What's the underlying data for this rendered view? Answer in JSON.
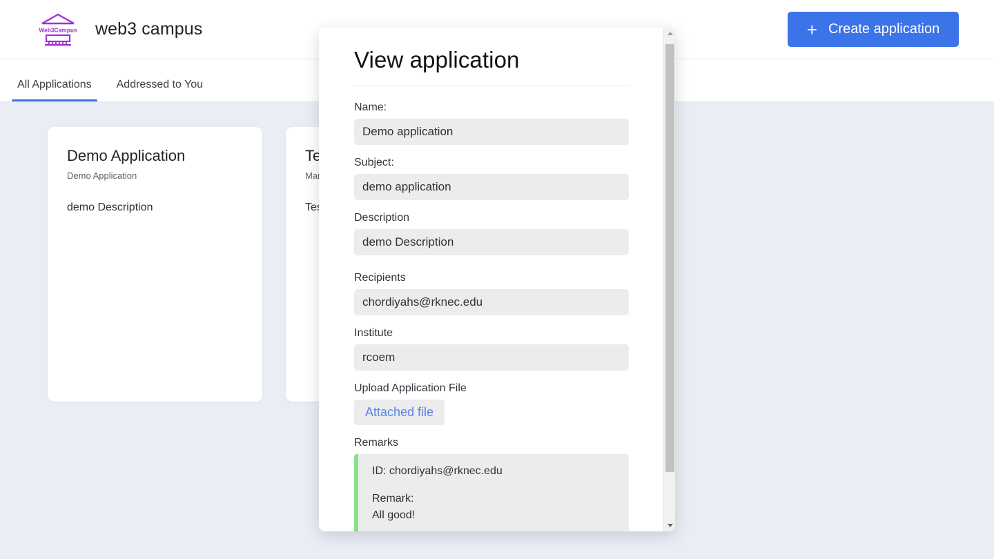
{
  "header": {
    "logo_icon": "web3campus-logo-icon",
    "logo_text": "Web3Campus",
    "brand_name": "web3 campus",
    "create_button": {
      "icon": "plus-icon",
      "icon_glyph": "+",
      "label": "Create application"
    },
    "accent_color": "#3b73e8"
  },
  "tabs": [
    {
      "label": "All Applications",
      "active": true
    },
    {
      "label": "Addressed to You",
      "active": false
    }
  ],
  "cards": [
    {
      "title": "Demo Application",
      "subtitle": "Demo Application",
      "description": "demo Description"
    },
    {
      "title": "Test",
      "subtitle": "Manage",
      "description": "Test"
    }
  ],
  "modal": {
    "title": "View application",
    "fields": [
      {
        "label": "Name:",
        "value": "Demo application"
      },
      {
        "label": "Subject:",
        "value": "demo application"
      },
      {
        "label": "Description",
        "value": "demo Description"
      },
      {
        "label": "Recipients",
        "value": "chordiyahs@rknec.edu"
      },
      {
        "label": "Institute",
        "value": "rcoem"
      }
    ],
    "upload": {
      "label": "Upload Application File",
      "button_label": "Attached file",
      "link_color": "#5b84e8"
    },
    "remarks": {
      "label": "Remarks",
      "id_line": "ID: chordiyahs@rknec.edu",
      "remark_label": "Remark:",
      "remark_text": "All good!",
      "accent_color": "#83e28a"
    },
    "scrollbar": {
      "up_icon": "chevron-up-icon",
      "down_icon": "chevron-down-icon"
    }
  },
  "colors": {
    "page_background": "#eaeef4",
    "surface": "#ffffff",
    "field_background": "#ececec",
    "primary": "#3b73e8",
    "logo_purple": "#a02fd6"
  }
}
